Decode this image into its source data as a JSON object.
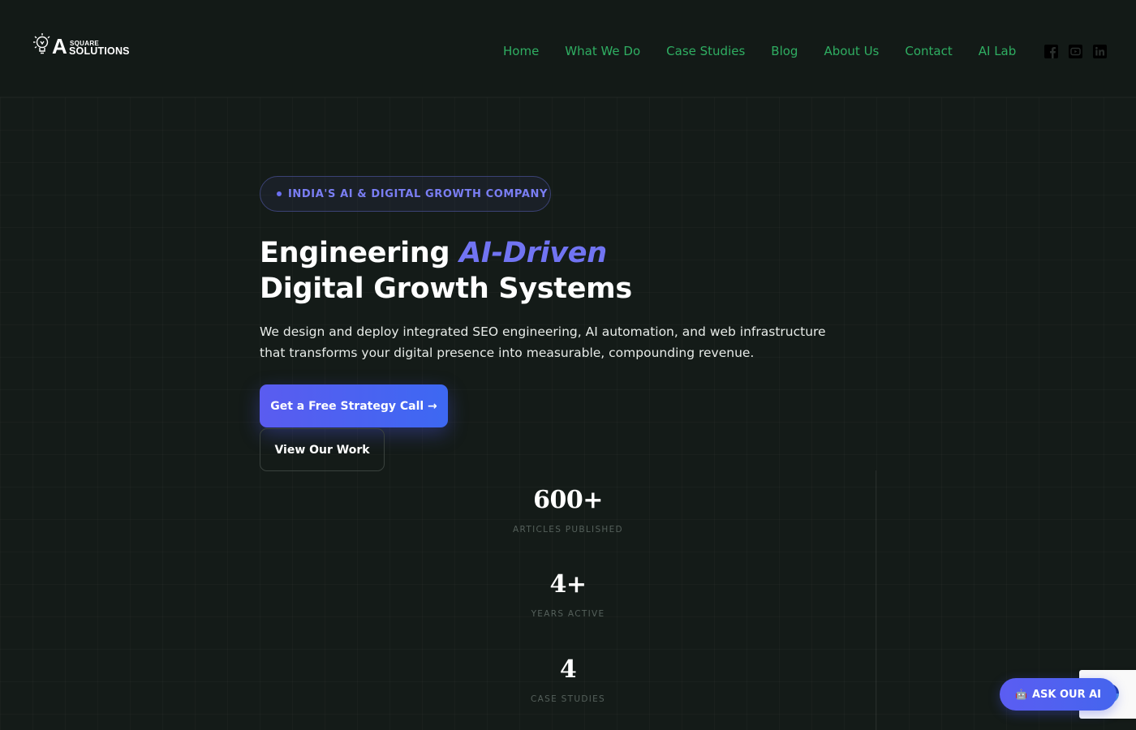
{
  "brand": {
    "logo_letter": "A",
    "logo_top": "SQUARE",
    "logo_bottom": "SOLUTIONS"
  },
  "nav": {
    "items": [
      {
        "label": "Home"
      },
      {
        "label": "What We Do"
      },
      {
        "label": "Case Studies"
      },
      {
        "label": "Blog"
      },
      {
        "label": "About Us"
      },
      {
        "label": "Contact"
      },
      {
        "label": "AI Lab"
      }
    ],
    "link_color": "#2fae62"
  },
  "socials": [
    {
      "icon": "facebook-icon"
    },
    {
      "icon": "youtube-icon"
    },
    {
      "icon": "linkedin-icon"
    }
  ],
  "hero": {
    "badge": "INDIA'S AI & DIGITAL GROWTH COMPANY",
    "headline_part1": "Engineering ",
    "headline_accent": "AI-Driven",
    "headline_part2": "Digital Growth Systems",
    "subtext": "We design and deploy integrated SEO engineering, AI automation, and web infrastructure that transforms your digital presence into measurable, compounding revenue.",
    "primary_cta": "Get a Free Strategy Call →",
    "secondary_cta": "View Our Work",
    "accent_color": "#7174f2"
  },
  "stats": [
    {
      "value": "600+",
      "label": "ARTICLES PUBLISHED"
    },
    {
      "value": "4+",
      "label": "YEARS ACTIVE"
    },
    {
      "value": "4",
      "label": "CASE STUDIES"
    }
  ],
  "chat_widget": {
    "icon": "robot-icon",
    "label": "ASK OUR AI"
  },
  "colors": {
    "background": "#141b18",
    "primary_button": "#5a5cf0"
  }
}
